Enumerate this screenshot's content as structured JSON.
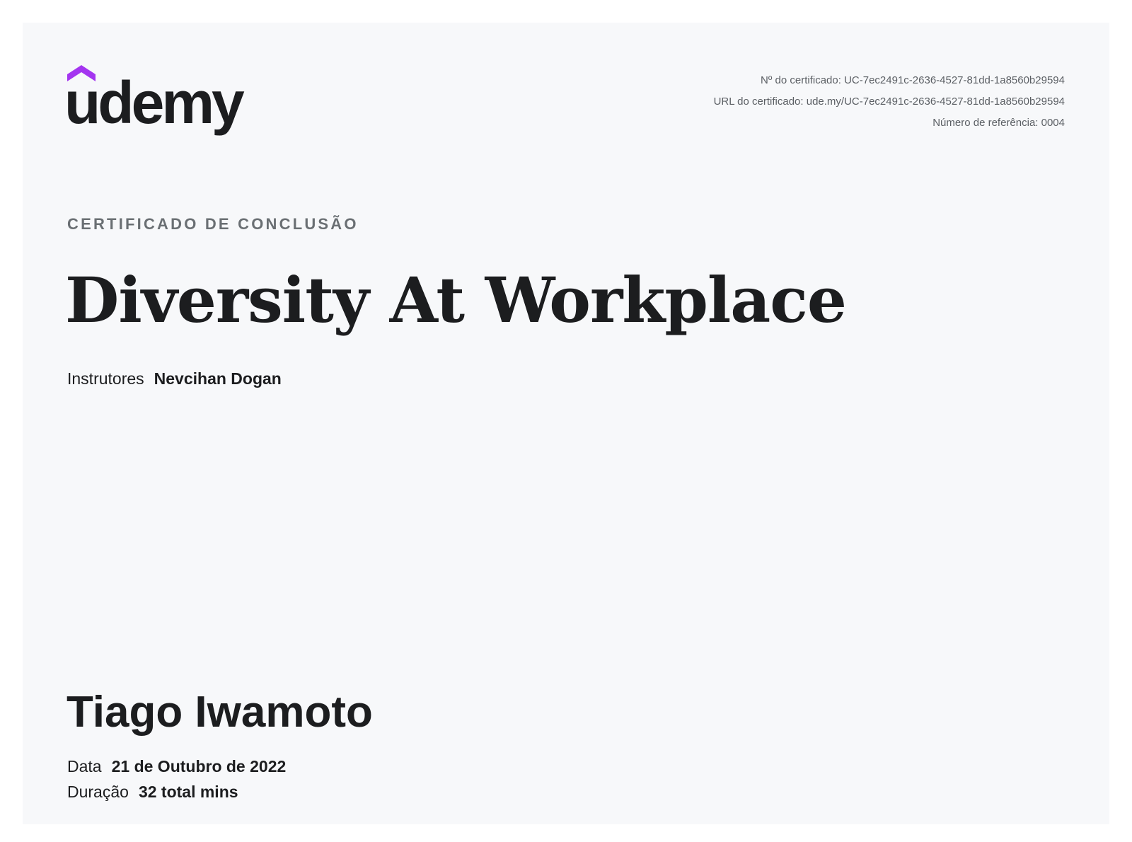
{
  "brand": {
    "wordmark": "udemy",
    "icon": "udemy-hat-icon",
    "accent_color": "#a435f0"
  },
  "meta": {
    "certificate_number": "Nº do certificado: UC-7ec2491c-2636-4527-81dd-1a8560b29594",
    "certificate_url": "URL do certificado: ude.my/UC-7ec2491c-2636-4527-81dd-1a8560b29594",
    "reference_number": "Número de referência: 0004"
  },
  "certificate": {
    "kicker": "CERTIFICADO DE CONCLUSÃO",
    "course_title": "Diversity At Workplace",
    "instructors_label": "Instrutores",
    "instructor_name": "Nevcihan Dogan",
    "student_name": "Tiago Iwamoto",
    "date_label": "Data",
    "date_value": "21 de Outubro de 2022",
    "duration_label": "Duração",
    "duration_value": "32 total mins"
  }
}
